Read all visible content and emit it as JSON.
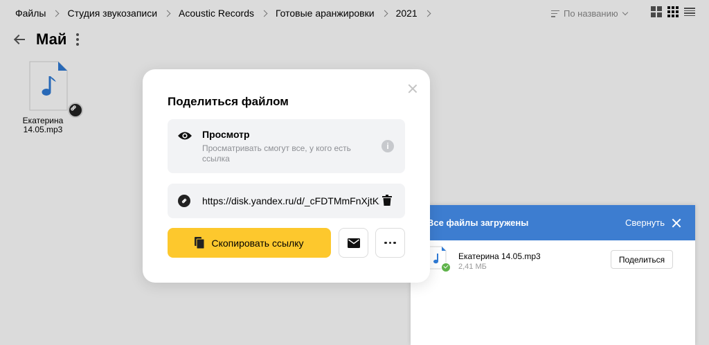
{
  "breadcrumb": [
    "Файлы",
    "Студия звукозаписи",
    "Acoustic Records",
    "Готовые аранжировки",
    "2021"
  ],
  "toolbar": {
    "sort_label": "По названию"
  },
  "page": {
    "title": "Май"
  },
  "file": {
    "name": "Екатерина 14.05.mp3"
  },
  "modal": {
    "title": "Поделиться файлом",
    "access_title": "Просмотр",
    "access_desc": "Просматривать смогут все, у кого есть ссылка",
    "info_glyph": "i",
    "link_value": "https://disk.yandex.ru/d/_cFDTMmFnXjtKZQ",
    "copy_label": "Скопировать ссылку"
  },
  "upload": {
    "title": "Все файлы загружены",
    "collapse_label": "Свернуть",
    "file_name": "Екатерина 14.05.mp3",
    "file_size": "2,41 МБ",
    "share_label": "Поделиться"
  },
  "colors": {
    "accent_yellow": "#fdc82d",
    "upload_header_blue": "#3d7dd0",
    "music_icon_blue": "#2f7bd6",
    "success_green": "#5fb34a"
  }
}
